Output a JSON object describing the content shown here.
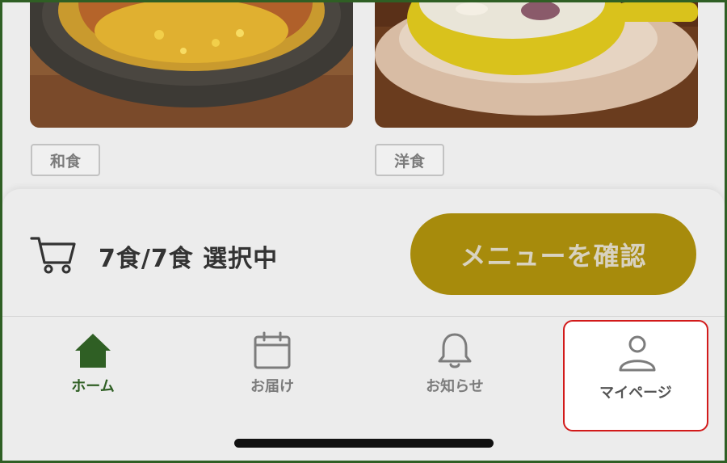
{
  "cards": [
    {
      "image_alt": "和食",
      "tag": "和食"
    },
    {
      "image_alt": "洋食",
      "tag": "洋食"
    }
  ],
  "cart": {
    "icon": "cart-icon",
    "count_text": "7食/7食 選択中",
    "confirm_label": "メニューを確認"
  },
  "nav": {
    "home": {
      "label": "ホーム",
      "icon": "home-icon"
    },
    "delivery": {
      "label": "お届け",
      "icon": "calendar-icon"
    },
    "notice": {
      "label": "お知らせ",
      "icon": "bell-icon"
    },
    "mypage": {
      "label": "マイページ",
      "icon": "user-icon"
    }
  },
  "colors": {
    "brand_green": "#2f5f24",
    "confirm_button": "#a78b0c",
    "highlight_border": "#d21a1a"
  }
}
